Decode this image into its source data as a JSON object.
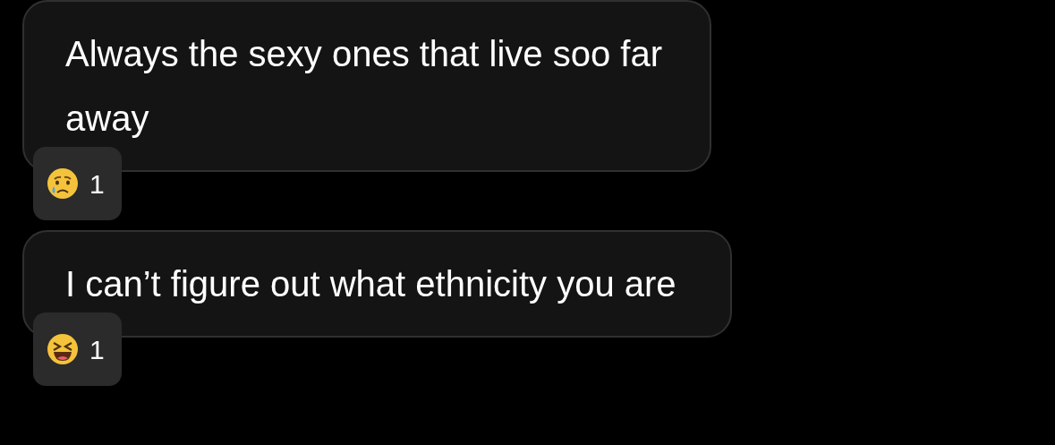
{
  "messages": [
    {
      "text": "Always the sexy ones that live soo far away",
      "reaction": {
        "kind": "crying",
        "count": "1"
      }
    },
    {
      "text": "I can’t figure out what ethnicity you are",
      "reaction": {
        "kind": "laughing",
        "count": "1"
      }
    }
  ]
}
